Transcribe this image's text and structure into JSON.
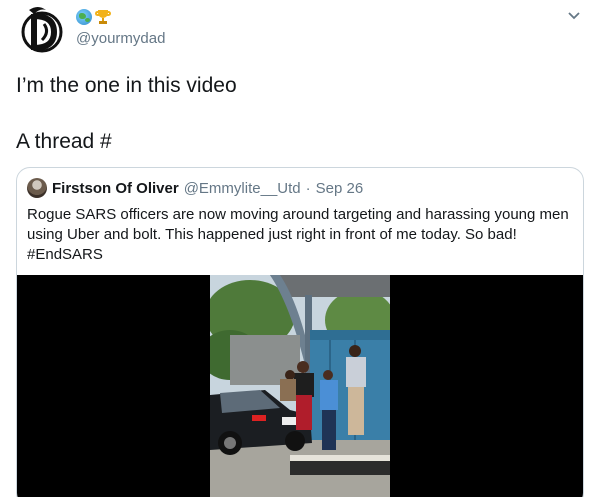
{
  "author": {
    "handle": "@yourmydad",
    "name_icons": [
      "globe-emoji-icon",
      "trophy-emoji-icon"
    ]
  },
  "tweet": {
    "lines": [
      "I’m the one in this video",
      "A thread #"
    ]
  },
  "quoted_tweet": {
    "name": "Firstson Of Oliver",
    "handle": "@Emmylite__Utd",
    "separator": "·",
    "date": "Sep 26",
    "text_lines": [
      "Rogue SARS officers are now moving around targeting and harassing young men",
      "using Uber and bolt. This happened just right in front of me today. So bad!",
      "#EndSARS"
    ],
    "media": "video-thumbnail"
  },
  "colors": {
    "text": "#14171a",
    "secondary": "#657786",
    "border": "#ccd6dd"
  }
}
